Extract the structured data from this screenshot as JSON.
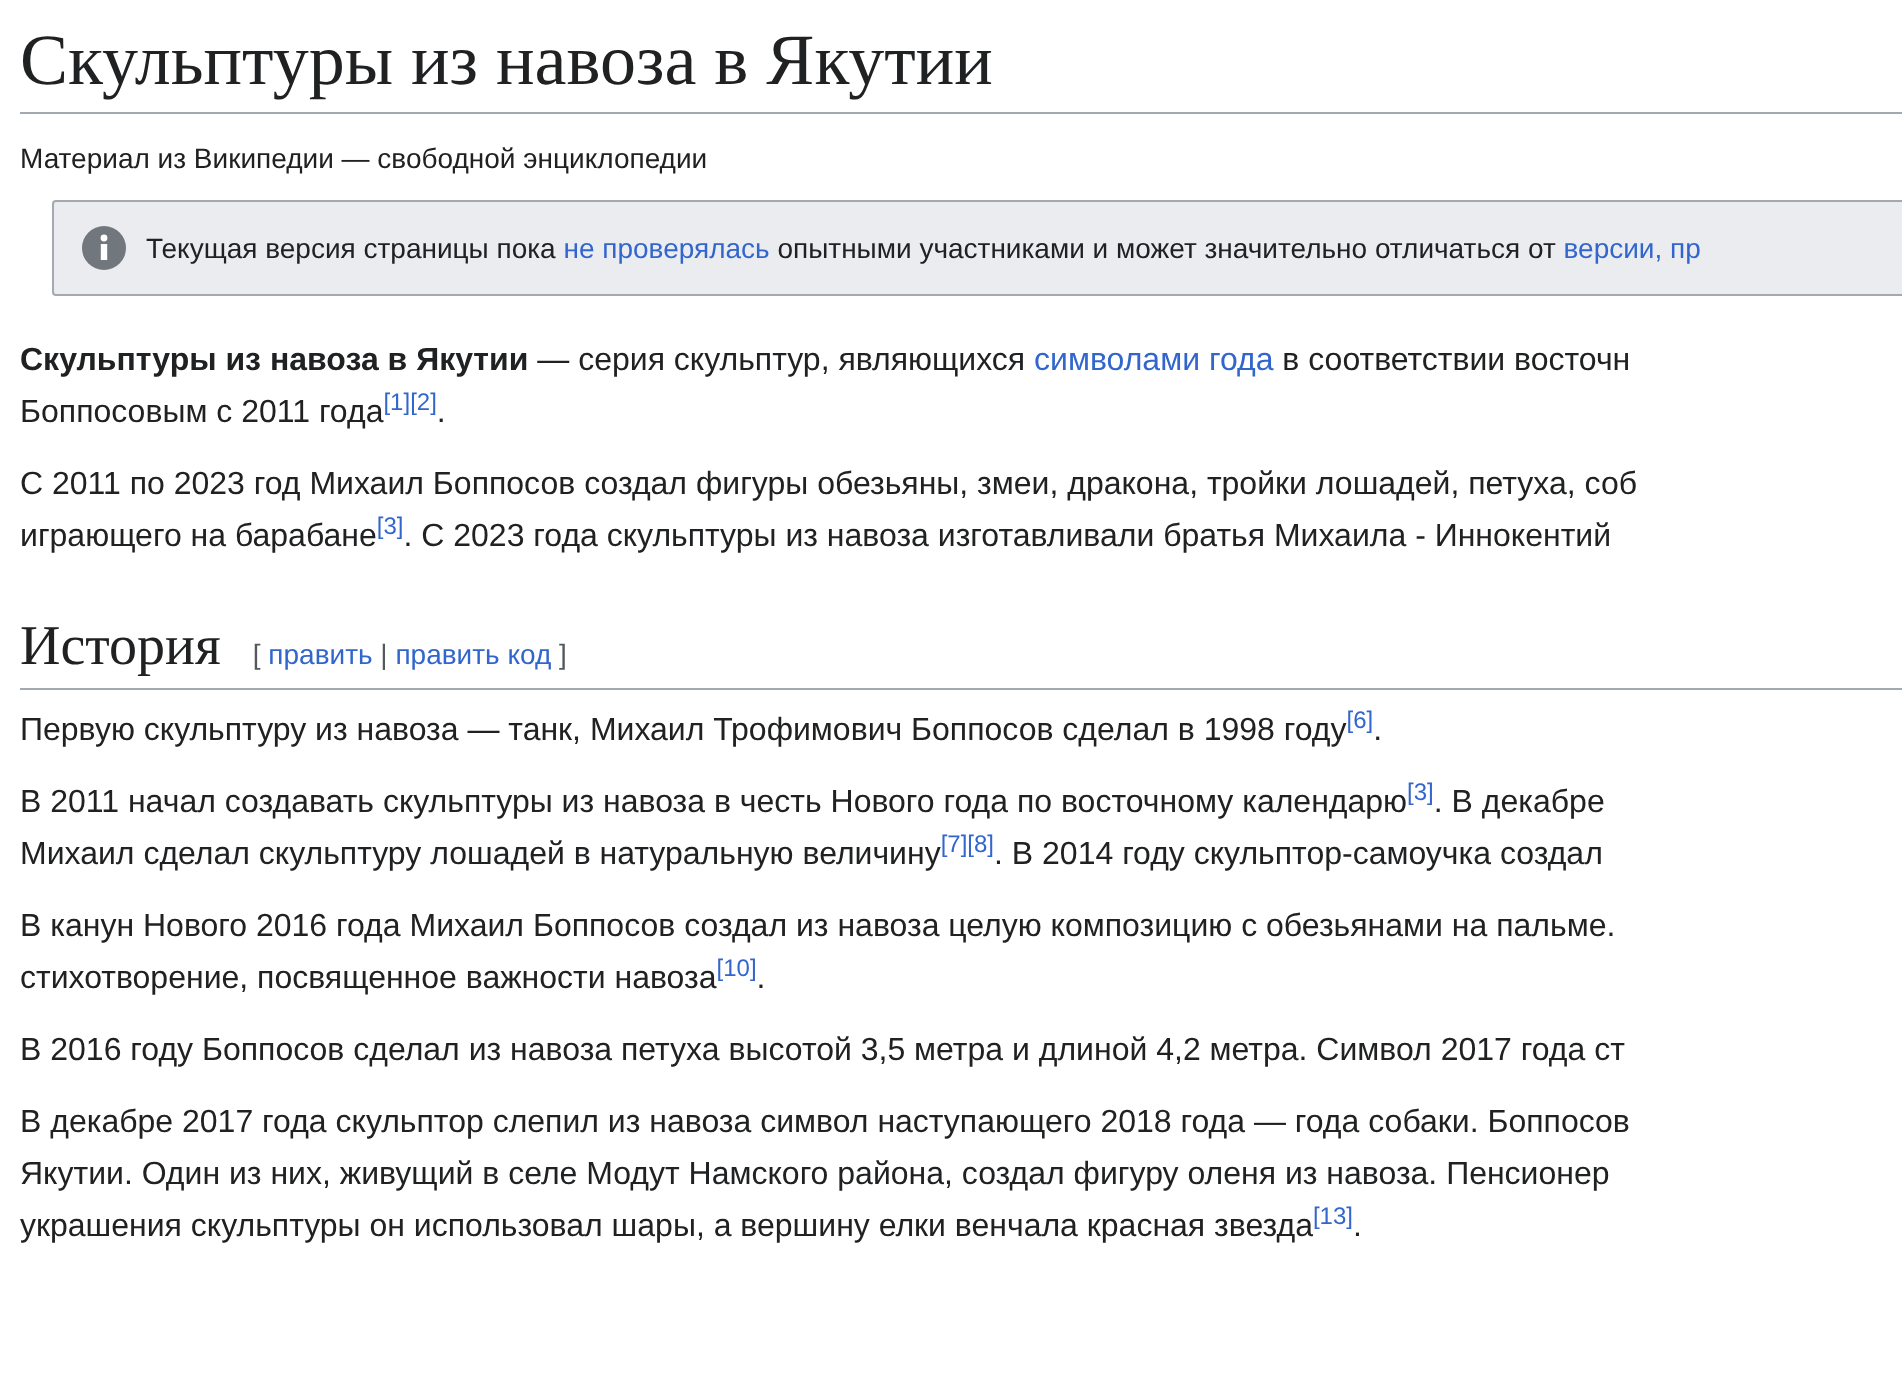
{
  "title": "Скульптуры из навоза в Якутии",
  "subtitle": "Материал из Википедии — свободной энциклопедии",
  "notice": [
    {
      "kind": "plain",
      "text": "Текущая версия страницы пока "
    },
    {
      "kind": "link",
      "text": "не проверялась"
    },
    {
      "kind": "plain",
      "text": " опытными участниками и может значительно отличаться от "
    },
    {
      "kind": "link",
      "text": "версии, пр"
    }
  ],
  "intro": [
    [
      [
        {
          "kind": "bold",
          "text": "Скульптуры из навоза в Якутии"
        },
        {
          "kind": "plain",
          "text": " — серия скульптур, являющихся "
        },
        {
          "kind": "link",
          "text": "символами года"
        },
        {
          "kind": "plain",
          "text": " в соответствии восточн"
        }
      ],
      [
        {
          "kind": "plain",
          "text": "Боппосовым с 2011 года"
        },
        {
          "kind": "ref",
          "text": "[1]"
        },
        {
          "kind": "ref",
          "text": "[2]"
        },
        {
          "kind": "plain",
          "text": "."
        }
      ]
    ],
    [
      [
        {
          "kind": "plain",
          "text": "С 2011 по 2023 год Михаил Боппосов создал фигуры обезьяны, змеи, дракона, тройки лошадей, петуха, соб"
        }
      ],
      [
        {
          "kind": "plain",
          "text": "играющего на барабане"
        },
        {
          "kind": "ref",
          "text": "[3]"
        },
        {
          "kind": "plain",
          "text": ". С 2023 года скульптуры из навоза изготавливали братья Михаила - Иннокентий"
        }
      ]
    ]
  ],
  "section": {
    "heading": "История",
    "edit_links": [
      {
        "kind": "bracket",
        "text": "[ "
      },
      {
        "kind": "link",
        "text": "править"
      },
      {
        "kind": "bracket",
        "text": " | "
      },
      {
        "kind": "link",
        "text": "править код"
      },
      {
        "kind": "bracket",
        "text": " ]"
      }
    ],
    "paragraphs": [
      [
        [
          {
            "kind": "plain",
            "text": "Первую скульптуру из навоза — танк, Михаил Трофимович Боппосов сделал в 1998 году"
          },
          {
            "kind": "ref",
            "text": "[6]"
          },
          {
            "kind": "plain",
            "text": "."
          }
        ]
      ],
      [
        [
          {
            "kind": "plain",
            "text": "В 2011 начал создавать скульптуры из навоза в честь Нового года по восточному календарю"
          },
          {
            "kind": "ref",
            "text": "[3]"
          },
          {
            "kind": "plain",
            "text": ". В декабре"
          }
        ],
        [
          {
            "kind": "plain",
            "text": "Михаил сделал скульптуру лошадей в натуральную величину"
          },
          {
            "kind": "ref",
            "text": "[7]"
          },
          {
            "kind": "ref",
            "text": "[8]"
          },
          {
            "kind": "plain",
            "text": ". В 2014 году скульптор-самоучка создал"
          }
        ]
      ],
      [
        [
          {
            "kind": "plain",
            "text": "В канун Нового 2016 года Михаил Боппосов создал из навоза целую композицию с обезьянами на пальме."
          }
        ],
        [
          {
            "kind": "plain",
            "text": "стихотворение, посвященное важности навоза"
          },
          {
            "kind": "ref",
            "text": "[10]"
          },
          {
            "kind": "plain",
            "text": "."
          }
        ]
      ],
      [
        [
          {
            "kind": "plain",
            "text": "В 2016 году Боппосов сделал из навоза петуха высотой 3,5 метра и длиной 4,2 метра. Символ 2017 года ст"
          }
        ]
      ],
      [
        [
          {
            "kind": "plain",
            "text": "В декабре 2017 года скульптор слепил из навоза символ наступающего 2018 года — года собаки. Боппосов"
          }
        ],
        [
          {
            "kind": "plain",
            "text": "Якутии. Один из них, живущий в селе Модут Намского района, создал фигуру оленя из навоза. Пенсионер"
          }
        ],
        [
          {
            "kind": "plain",
            "text": "украшения скульптуры он использовал шары, а вершину елки венчала красная звезда"
          },
          {
            "kind": "ref",
            "text": "[13]"
          },
          {
            "kind": "plain",
            "text": "."
          }
        ]
      ]
    ]
  }
}
